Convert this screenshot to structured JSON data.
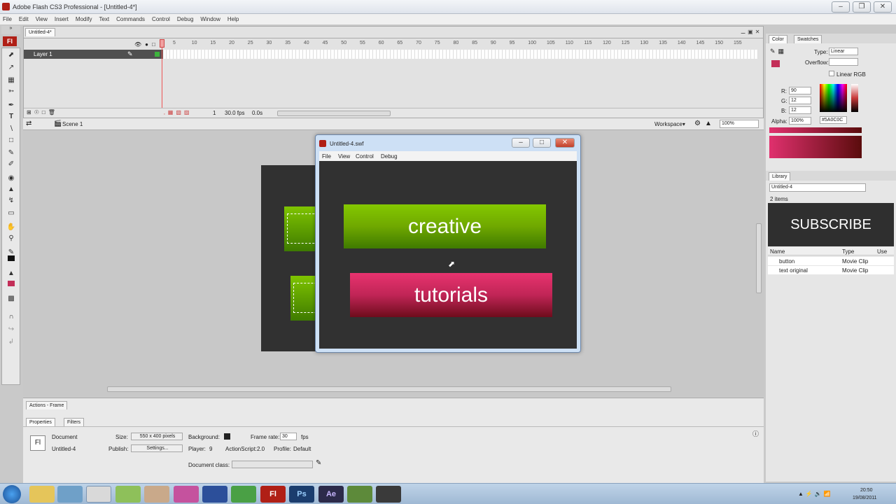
{
  "app": {
    "title": "Adobe Flash CS3 Professional - [Untitled-4*]"
  },
  "menu": [
    "File",
    "Edit",
    "View",
    "Insert",
    "Modify",
    "Text",
    "Commands",
    "Control",
    "Debug",
    "Window",
    "Help"
  ],
  "timeline": {
    "tab": "Untitled-4*",
    "layer": "Layer 1",
    "frame_numbers": [
      "5",
      "10",
      "15",
      "20",
      "25",
      "30",
      "35",
      "40",
      "45",
      "50",
      "55",
      "60",
      "65",
      "70",
      "75",
      "80",
      "85",
      "90",
      "95",
      "100",
      "105",
      "110",
      "115",
      "120",
      "125",
      "130",
      "135",
      "140",
      "145",
      "150",
      "155"
    ],
    "current_frame": "1",
    "fps": "30.0 fps",
    "time": "0.0s"
  },
  "scene": {
    "label": "Scene 1",
    "workspace": "Workspace",
    "zoom": "100%"
  },
  "swf": {
    "title": "Untitled-4.swf",
    "menu": [
      "File",
      "View",
      "Control",
      "Debug"
    ],
    "button1": "creative",
    "button2": "tutorials"
  },
  "color": {
    "tabs": [
      "Color",
      "Swatches"
    ],
    "type_label": "Type:",
    "type_value": "Linear",
    "overflow_label": "Overflow:",
    "linear_rgb": "Linear RGB",
    "r_label": "R:",
    "r": "90",
    "g_label": "G:",
    "g": "12",
    "b_label": "B:",
    "b": "12",
    "alpha_label": "Alpha:",
    "alpha": "100%",
    "hex": "#5A0C0C"
  },
  "library": {
    "tab": "Library",
    "doc": "Untitled-4",
    "count": "2 items",
    "banner": "SUBSCRIBE",
    "headers": [
      "Name",
      "Type",
      "Use"
    ],
    "items": [
      {
        "name": "button",
        "type": "Movie Clip"
      },
      {
        "name": "text original",
        "type": "Movie Clip"
      }
    ]
  },
  "actions": {
    "tab": "Actions - Frame"
  },
  "properties": {
    "tabs": [
      "Properties",
      "Filters"
    ],
    "doc_label": "Document",
    "doc_name": "Untitled-4",
    "size_label": "Size:",
    "size_value": "550 x 400 pixels",
    "bg_label": "Background:",
    "fr_label": "Frame rate:",
    "fr_value": "30",
    "fps": "fps",
    "publish_label": "Publish:",
    "settings": "Settings...",
    "player_label": "Player:",
    "player": "9",
    "as_label": "ActionScript:",
    "as": "2.0",
    "profile_label": "Profile:",
    "profile": "Default",
    "docclass_label": "Document class:"
  },
  "clock": {
    "time": "20:50",
    "date": "19/08/2011"
  },
  "colors": {
    "green": "#6fb300",
    "pink": "#d9306a",
    "stage": "#313131"
  }
}
